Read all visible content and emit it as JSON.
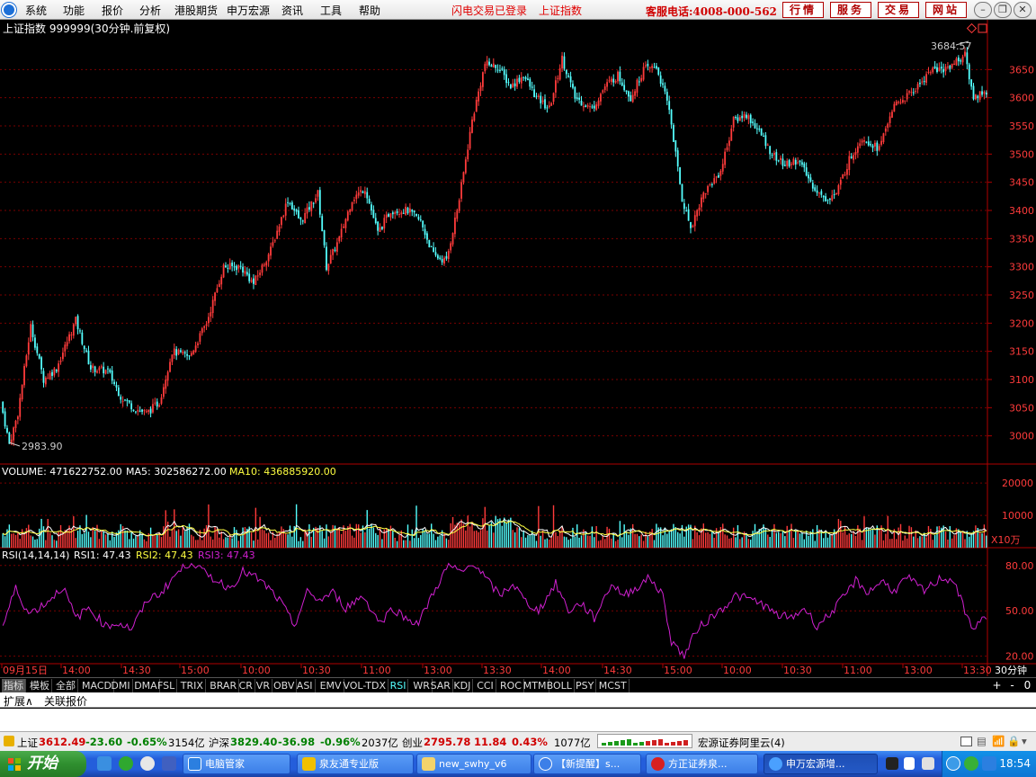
{
  "menubar": {
    "items": [
      "系统",
      "功能",
      "报价",
      "分析",
      "港股期货",
      "申万宏源",
      "资讯",
      "工具",
      "帮助"
    ],
    "flash_login": "闪电交易已登录",
    "index_name": "上证指数",
    "hotline": "客服电话:4008-000-562",
    "buttons": [
      "行情",
      "服务",
      "交易",
      "网站"
    ]
  },
  "chart_header": {
    "title": "上证指数 999999(30分钟.前复权)",
    "high_label": "3684.57",
    "low_label": "2983.90"
  },
  "volume_header": {
    "volume": "VOLUME: 471622752.00",
    "ma5": "MA5: 302586272.00",
    "ma10": "MA10: 436885920.00",
    "unit": "X10万"
  },
  "rsi_header": {
    "name": "RSI(14,14,14)",
    "rsi1": "RSI1: 47.43",
    "rsi2": "RSI2: 47.43",
    "rsi3": "RSI3: 47.43"
  },
  "time_axis": {
    "labels": [
      "09月15日",
      "14:00",
      "14:30",
      "15:00",
      "10:00",
      "10:30",
      "11:00",
      "13:00",
      "13:30",
      "14:00",
      "14:30",
      "15:00",
      "10:00",
      "10:30",
      "11:00",
      "13:00",
      "13:30"
    ],
    "period": "30分钟"
  },
  "indicator_tabs": [
    "指标",
    "模板",
    "全部",
    "MACD",
    "DMI",
    "DMA",
    "FSL",
    "TRIX",
    "BRAR",
    "CR",
    "VR",
    "OBV",
    "ASI",
    "EMV",
    "VOL-TDX",
    "RSI",
    "WR",
    "SAR",
    "KDJ",
    "CCI",
    "ROC",
    "MTM",
    "BOLL",
    "PSY",
    "MCST"
  ],
  "active_tab": "RSI",
  "tab_controls": [
    "+",
    "-",
    "0"
  ],
  "ext_bar": [
    "扩展∧",
    "关联报价"
  ],
  "statusbar": {
    "sh_name": "上证",
    "sh_value": "3612.49",
    "sh_change": "-23.60",
    "sh_pct": "-0.65%",
    "sh_amount": "3154亿",
    "hs_name": "沪深",
    "hs_value": "3829.40",
    "hs_change": "-36.98",
    "hs_pct": "-0.96%",
    "hs_amount": "2037亿",
    "cy_name": "创业",
    "cy_value": "2795.78",
    "cy_change": "11.84",
    "cy_pct": "0.43%",
    "cy_amount": "1077亿",
    "server": "宏源证券阿里云(4)"
  },
  "taskbar": {
    "start": "开始",
    "windows": [
      "电脑管家",
      "泉友通专业版",
      "new_swhy_v6",
      "【新提醒】s...",
      "方正证券泉...",
      "申万宏源增..."
    ],
    "clock": "18:54"
  },
  "colors": {
    "up": "#ff3b3b",
    "down": "#54ffff",
    "grid": "#7a0000",
    "rsi": "#d020d0",
    "ma5": "#ffffff",
    "ma10": "#ffff40"
  },
  "chart_data": {
    "type": "candlestick",
    "title": "上证指数 999999(30分钟.前复权)",
    "price_axis": {
      "min": 2950,
      "max": 3700,
      "ticks": [
        3000,
        3050,
        3100,
        3150,
        3200,
        3250,
        3300,
        3350,
        3400,
        3450,
        3500,
        3550,
        3600,
        3650
      ]
    },
    "volume_axis": {
      "unit": "X10万",
      "max": 22000,
      "ticks": [
        10000,
        20000
      ]
    },
    "rsi_axis": {
      "min": 15,
      "max": 90,
      "ticks": [
        20,
        50,
        80
      ]
    },
    "price_anchors": [
      [
        0,
        3060
      ],
      [
        4,
        2985
      ],
      [
        8,
        3040
      ],
      [
        14,
        3195
      ],
      [
        20,
        3100
      ],
      [
        26,
        3120
      ],
      [
        35,
        3205
      ],
      [
        42,
        3120
      ],
      [
        50,
        3115
      ],
      [
        56,
        3070
      ],
      [
        62,
        3050
      ],
      [
        68,
        3040
      ],
      [
        74,
        3060
      ],
      [
        80,
        3150
      ],
      [
        88,
        3140
      ],
      [
        96,
        3200
      ],
      [
        104,
        3300
      ],
      [
        112,
        3300
      ],
      [
        118,
        3270
      ],
      [
        126,
        3330
      ],
      [
        134,
        3420
      ],
      [
        140,
        3380
      ],
      [
        148,
        3430
      ],
      [
        152,
        3300
      ],
      [
        158,
        3350
      ],
      [
        164,
        3420
      ],
      [
        170,
        3440
      ],
      [
        176,
        3360
      ],
      [
        182,
        3400
      ],
      [
        190,
        3400
      ],
      [
        196,
        3380
      ],
      [
        202,
        3320
      ],
      [
        208,
        3310
      ],
      [
        214,
        3420
      ],
      [
        220,
        3560
      ],
      [
        226,
        3660
      ],
      [
        232,
        3655
      ],
      [
        238,
        3620
      ],
      [
        244,
        3640
      ],
      [
        250,
        3600
      ],
      [
        256,
        3580
      ],
      [
        262,
        3670
      ],
      [
        268,
        3600
      ],
      [
        276,
        3580
      ],
      [
        282,
        3620
      ],
      [
        288,
        3640
      ],
      [
        294,
        3600
      ],
      [
        300,
        3650
      ],
      [
        306,
        3655
      ],
      [
        312,
        3580
      ],
      [
        318,
        3420
      ],
      [
        322,
        3370
      ],
      [
        328,
        3430
      ],
      [
        336,
        3470
      ],
      [
        342,
        3560
      ],
      [
        348,
        3570
      ],
      [
        354,
        3540
      ],
      [
        360,
        3500
      ],
      [
        366,
        3480
      ],
      [
        372,
        3490
      ],
      [
        378,
        3450
      ],
      [
        384,
        3420
      ],
      [
        390,
        3430
      ],
      [
        396,
        3490
      ],
      [
        402,
        3530
      ],
      [
        410,
        3510
      ],
      [
        416,
        3580
      ],
      [
        422,
        3600
      ],
      [
        428,
        3620
      ],
      [
        434,
        3650
      ],
      [
        440,
        3650
      ],
      [
        446,
        3665
      ],
      [
        450,
        3675
      ],
      [
        454,
        3600
      ],
      [
        458,
        3610
      ]
    ],
    "rsi_anchors": [
      [
        0,
        40
      ],
      [
        6,
        65
      ],
      [
        12,
        48
      ],
      [
        20,
        55
      ],
      [
        28,
        66
      ],
      [
        34,
        45
      ],
      [
        40,
        52
      ],
      [
        48,
        40
      ],
      [
        54,
        42
      ],
      [
        60,
        38
      ],
      [
        68,
        58
      ],
      [
        74,
        62
      ],
      [
        80,
        73
      ],
      [
        88,
        83
      ],
      [
        94,
        75
      ],
      [
        100,
        70
      ],
      [
        106,
        65
      ],
      [
        112,
        76
      ],
      [
        118,
        72
      ],
      [
        124,
        65
      ],
      [
        130,
        55
      ],
      [
        136,
        40
      ],
      [
        142,
        62
      ],
      [
        148,
        57
      ],
      [
        154,
        62
      ],
      [
        160,
        52
      ],
      [
        168,
        60
      ],
      [
        176,
        42
      ],
      [
        182,
        52
      ],
      [
        188,
        45
      ],
      [
        194,
        42
      ],
      [
        202,
        65
      ],
      [
        208,
        80
      ],
      [
        214,
        75
      ],
      [
        220,
        82
      ],
      [
        226,
        70
      ],
      [
        232,
        60
      ],
      [
        238,
        68
      ],
      [
        244,
        56
      ],
      [
        250,
        50
      ],
      [
        258,
        68
      ],
      [
        264,
        50
      ],
      [
        270,
        55
      ],
      [
        276,
        45
      ],
      [
        284,
        68
      ],
      [
        290,
        60
      ],
      [
        296,
        66
      ],
      [
        302,
        72
      ],
      [
        308,
        60
      ],
      [
        312,
        30
      ],
      [
        318,
        20
      ],
      [
        324,
        38
      ],
      [
        330,
        45
      ],
      [
        336,
        52
      ],
      [
        342,
        60
      ],
      [
        348,
        58
      ],
      [
        354,
        55
      ],
      [
        360,
        48
      ],
      [
        368,
        45
      ],
      [
        374,
        52
      ],
      [
        380,
        40
      ],
      [
        386,
        48
      ],
      [
        392,
        58
      ],
      [
        398,
        70
      ],
      [
        404,
        62
      ],
      [
        410,
        70
      ],
      [
        416,
        63
      ],
      [
        422,
        72
      ],
      [
        430,
        63
      ],
      [
        438,
        72
      ],
      [
        444,
        70
      ],
      [
        450,
        45
      ],
      [
        454,
        38
      ],
      [
        458,
        47
      ]
    ]
  }
}
